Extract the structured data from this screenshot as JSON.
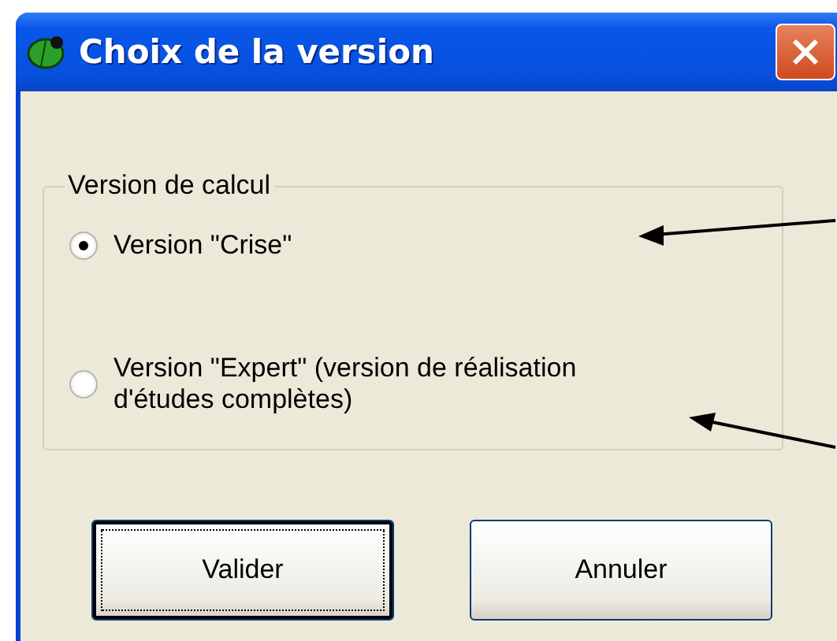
{
  "window": {
    "title": "Choix de la version"
  },
  "group": {
    "label": "Version de calcul",
    "options": [
      {
        "label": "Version \"Crise\"",
        "selected": true
      },
      {
        "label": "Version \"Expert\" (version de réalisation d'études complètes)",
        "selected": false
      }
    ]
  },
  "buttons": [
    {
      "label": "Valider",
      "focused": true
    },
    {
      "label": "Annuler",
      "focused": false
    }
  ]
}
